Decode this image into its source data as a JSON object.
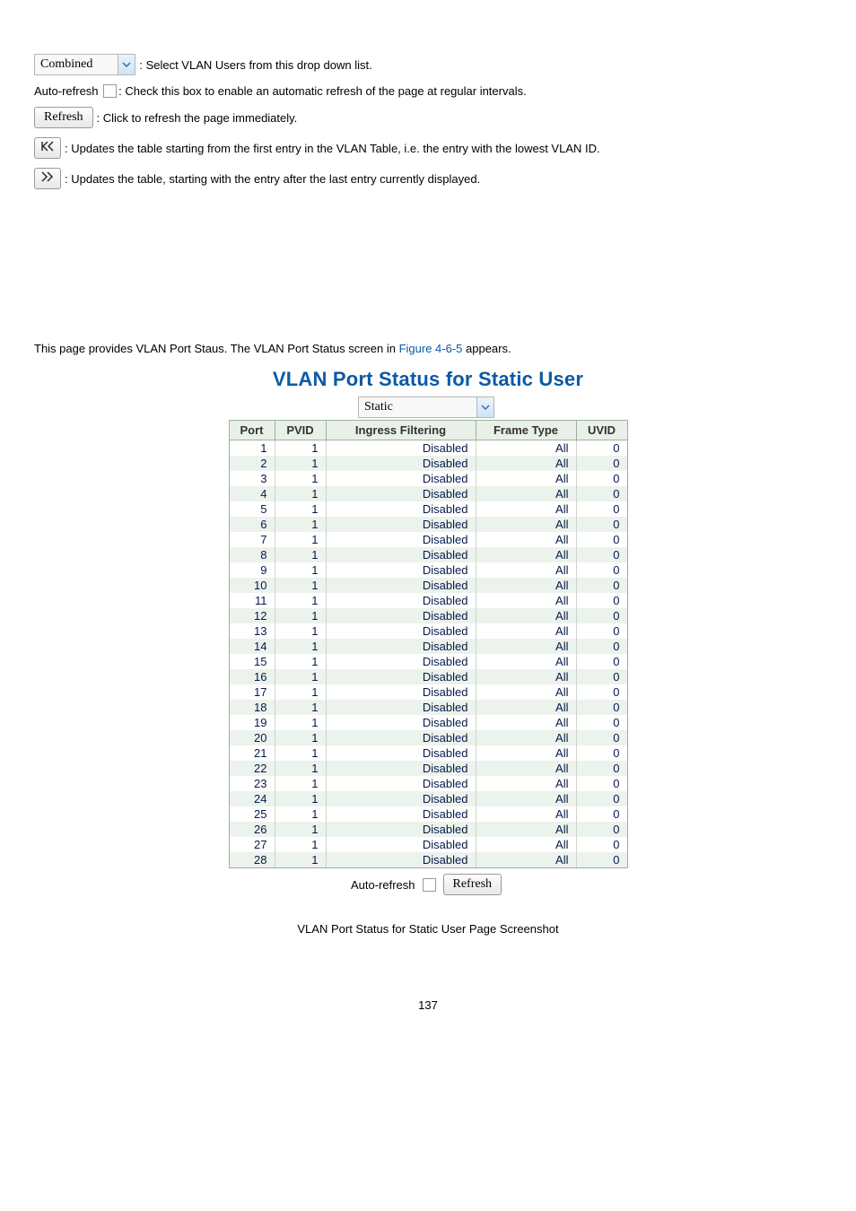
{
  "top": {
    "select_value": "Combined",
    "select_desc": ": Select VLAN Users from this drop down list.",
    "auto_refresh_label": "Auto-refresh",
    "auto_refresh_desc": ": Check this box to enable an automatic refresh of the page at regular intervals.",
    "refresh_btn": "Refresh",
    "refresh_desc": ": Click to refresh the page immediately.",
    "first_desc": ": Updates the table starting from the first entry in the VLAN Table, i.e. the entry with the lowest VLAN ID.",
    "next_desc": ": Updates the table, starting with the entry after the last entry currently displayed."
  },
  "section": {
    "intro_a": "This page provides VLAN Port Staus. The VLAN Port Status screen in ",
    "intro_link": "Figure 4-6-5",
    "intro_b": " appears.",
    "title": "VLAN Port Status for Static User",
    "select_value": "Static"
  },
  "table": {
    "headers": [
      "Port",
      "PVID",
      "Ingress Filtering",
      "Frame Type",
      "UVID"
    ],
    "rows": [
      {
        "port": 1,
        "pvid": 1,
        "ing": "Disabled",
        "ft": "All",
        "uv": 0
      },
      {
        "port": 2,
        "pvid": 1,
        "ing": "Disabled",
        "ft": "All",
        "uv": 0
      },
      {
        "port": 3,
        "pvid": 1,
        "ing": "Disabled",
        "ft": "All",
        "uv": 0
      },
      {
        "port": 4,
        "pvid": 1,
        "ing": "Disabled",
        "ft": "All",
        "uv": 0
      },
      {
        "port": 5,
        "pvid": 1,
        "ing": "Disabled",
        "ft": "All",
        "uv": 0
      },
      {
        "port": 6,
        "pvid": 1,
        "ing": "Disabled",
        "ft": "All",
        "uv": 0
      },
      {
        "port": 7,
        "pvid": 1,
        "ing": "Disabled",
        "ft": "All",
        "uv": 0
      },
      {
        "port": 8,
        "pvid": 1,
        "ing": "Disabled",
        "ft": "All",
        "uv": 0
      },
      {
        "port": 9,
        "pvid": 1,
        "ing": "Disabled",
        "ft": "All",
        "uv": 0
      },
      {
        "port": 10,
        "pvid": 1,
        "ing": "Disabled",
        "ft": "All",
        "uv": 0
      },
      {
        "port": 11,
        "pvid": 1,
        "ing": "Disabled",
        "ft": "All",
        "uv": 0
      },
      {
        "port": 12,
        "pvid": 1,
        "ing": "Disabled",
        "ft": "All",
        "uv": 0
      },
      {
        "port": 13,
        "pvid": 1,
        "ing": "Disabled",
        "ft": "All",
        "uv": 0
      },
      {
        "port": 14,
        "pvid": 1,
        "ing": "Disabled",
        "ft": "All",
        "uv": 0
      },
      {
        "port": 15,
        "pvid": 1,
        "ing": "Disabled",
        "ft": "All",
        "uv": 0
      },
      {
        "port": 16,
        "pvid": 1,
        "ing": "Disabled",
        "ft": "All",
        "uv": 0
      },
      {
        "port": 17,
        "pvid": 1,
        "ing": "Disabled",
        "ft": "All",
        "uv": 0
      },
      {
        "port": 18,
        "pvid": 1,
        "ing": "Disabled",
        "ft": "All",
        "uv": 0
      },
      {
        "port": 19,
        "pvid": 1,
        "ing": "Disabled",
        "ft": "All",
        "uv": 0
      },
      {
        "port": 20,
        "pvid": 1,
        "ing": "Disabled",
        "ft": "All",
        "uv": 0
      },
      {
        "port": 21,
        "pvid": 1,
        "ing": "Disabled",
        "ft": "All",
        "uv": 0
      },
      {
        "port": 22,
        "pvid": 1,
        "ing": "Disabled",
        "ft": "All",
        "uv": 0
      },
      {
        "port": 23,
        "pvid": 1,
        "ing": "Disabled",
        "ft": "All",
        "uv": 0
      },
      {
        "port": 24,
        "pvid": 1,
        "ing": "Disabled",
        "ft": "All",
        "uv": 0
      },
      {
        "port": 25,
        "pvid": 1,
        "ing": "Disabled",
        "ft": "All",
        "uv": 0
      },
      {
        "port": 26,
        "pvid": 1,
        "ing": "Disabled",
        "ft": "All",
        "uv": 0
      },
      {
        "port": 27,
        "pvid": 1,
        "ing": "Disabled",
        "ft": "All",
        "uv": 0
      },
      {
        "port": 28,
        "pvid": 1,
        "ing": "Disabled",
        "ft": "All",
        "uv": 0
      }
    ]
  },
  "under": {
    "auto_refresh_label": "Auto-refresh",
    "refresh_btn": "Refresh"
  },
  "caption": "VLAN Port Status for Static User Page Screenshot",
  "page_number": "137"
}
